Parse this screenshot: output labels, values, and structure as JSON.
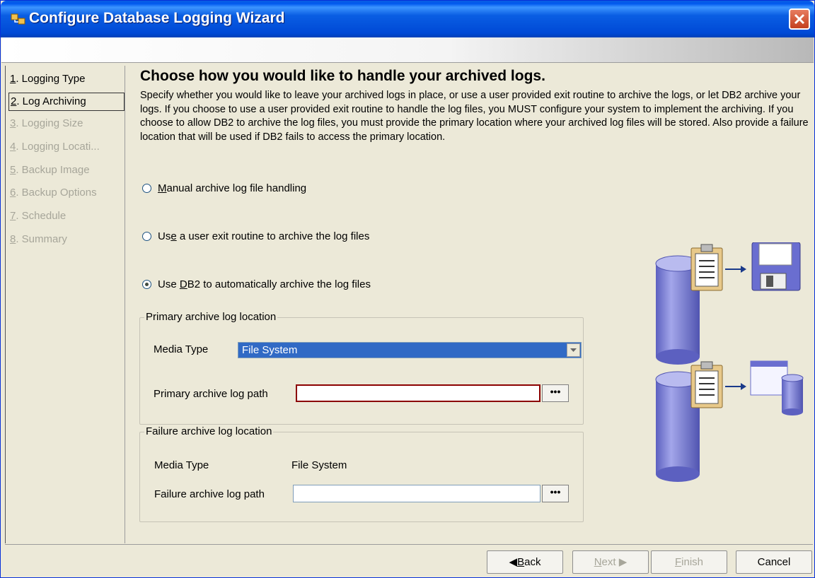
{
  "window": {
    "title": "Configure Database Logging Wizard"
  },
  "steps": [
    {
      "num": "1",
      "label": ". Logging Type",
      "state": "enabled"
    },
    {
      "num": "2",
      "label": ". Log Archiving",
      "state": "active"
    },
    {
      "num": "3",
      "label": ". Logging Size",
      "state": "disabled"
    },
    {
      "num": "4",
      "label": ". Logging Locati...",
      "state": "disabled"
    },
    {
      "num": "5",
      "label": ". Backup Image",
      "state": "disabled"
    },
    {
      "num": "6",
      "label": ". Backup Options",
      "state": "disabled"
    },
    {
      "num": "7",
      "label": ". Schedule",
      "state": "disabled"
    },
    {
      "num": "8",
      "label": ". Summary",
      "state": "disabled"
    }
  ],
  "main": {
    "heading": "Choose how you would like to handle your archived logs.",
    "description": "Specify whether you would like to leave your archived logs in place, or use a user provided exit routine to archive the logs, or let DB2 archive your logs. If you choose to use a user provided exit routine to handle the log files, you MUST configure your system to implement the archiving. If you choose to allow DB2 to archive the log files, you must provide the primary location where your archived log files will be stored. Also provide a failure location that will be used if DB2 fails to access the primary location.",
    "options": [
      {
        "mn": "M",
        "rest": "anual archive log file handling",
        "pre": "",
        "checked": false
      },
      {
        "pre": "Us",
        "mn": "e",
        "rest": " a user exit routine to archive the log files",
        "checked": false
      },
      {
        "pre": "Use ",
        "mn": "D",
        "rest": "B2 to automatically archive the log files",
        "checked": true
      }
    ],
    "primary": {
      "title": "Primary archive log location",
      "media_label": "Media Type",
      "media_value": "File System",
      "path_label": "Primary archive log path",
      "path_value": "",
      "browse": "•••"
    },
    "failure": {
      "title": "Failure archive log location",
      "media_label": "Media Type",
      "media_value": "File System",
      "path_label": "Failure archive log path",
      "path_value": "",
      "browse": "•••"
    }
  },
  "buttons": {
    "back_mn": "B",
    "back_rest": "ack",
    "next_mn": "N",
    "next_rest": "ext",
    "finish_mn": "F",
    "finish_rest": "inish",
    "cancel": "Cancel"
  },
  "colors": {
    "title_bar": "#0a5ee3",
    "selection": "#316ac5",
    "error_border": "#8b0000",
    "db_cylinder": "#7b7fd4"
  },
  "icons": [
    "wizard-app-icon",
    "close-icon",
    "dropdown-arrow-icon",
    "clipboard-icon",
    "database-icon",
    "floppy-disk-icon",
    "server-window-icon"
  ]
}
